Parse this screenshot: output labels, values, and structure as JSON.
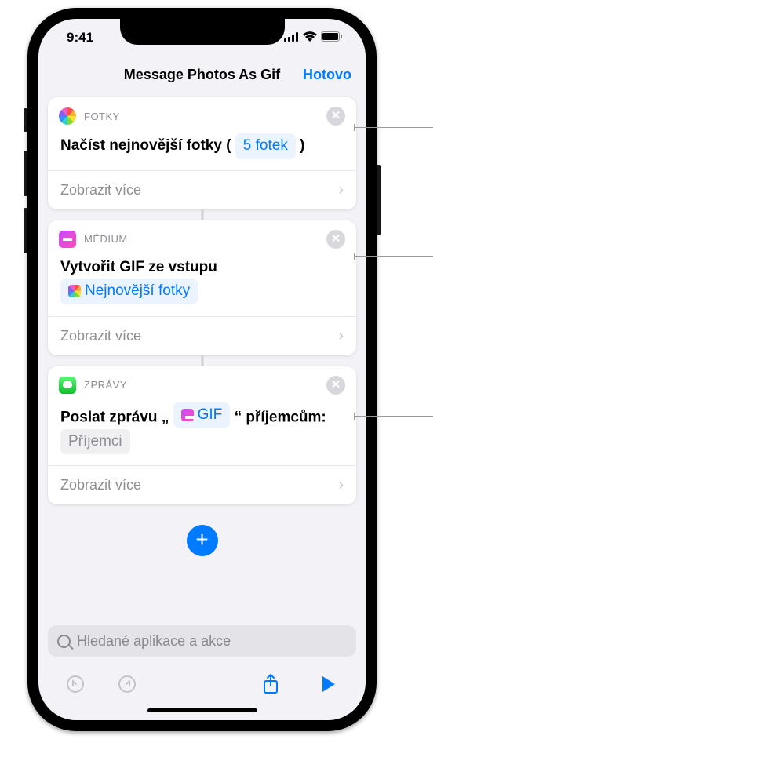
{
  "status": {
    "time": "9:41"
  },
  "nav": {
    "title": "Message Photos As Gif",
    "done": "Hotovo"
  },
  "card1": {
    "app": "FOTKY",
    "action_prefix": "Načíst nejnovější fotky (",
    "param": "5 fotek",
    "action_suffix": ")",
    "more": "Zobrazit více"
  },
  "card2": {
    "app": "MÉDIUM",
    "action": "Vytvořit GIF ze vstupu",
    "input_token": "Nejnovější fotky",
    "more": "Zobrazit více"
  },
  "card3": {
    "app": "ZPRÁVY",
    "action_prefix": "Poslat zprávu „",
    "gif_token": "GIF",
    "action_mid": "“ příjemcům:",
    "recipients_token": "Příjemci",
    "more": "Zobrazit více"
  },
  "search": {
    "placeholder": "Hledané aplikace a akce"
  }
}
